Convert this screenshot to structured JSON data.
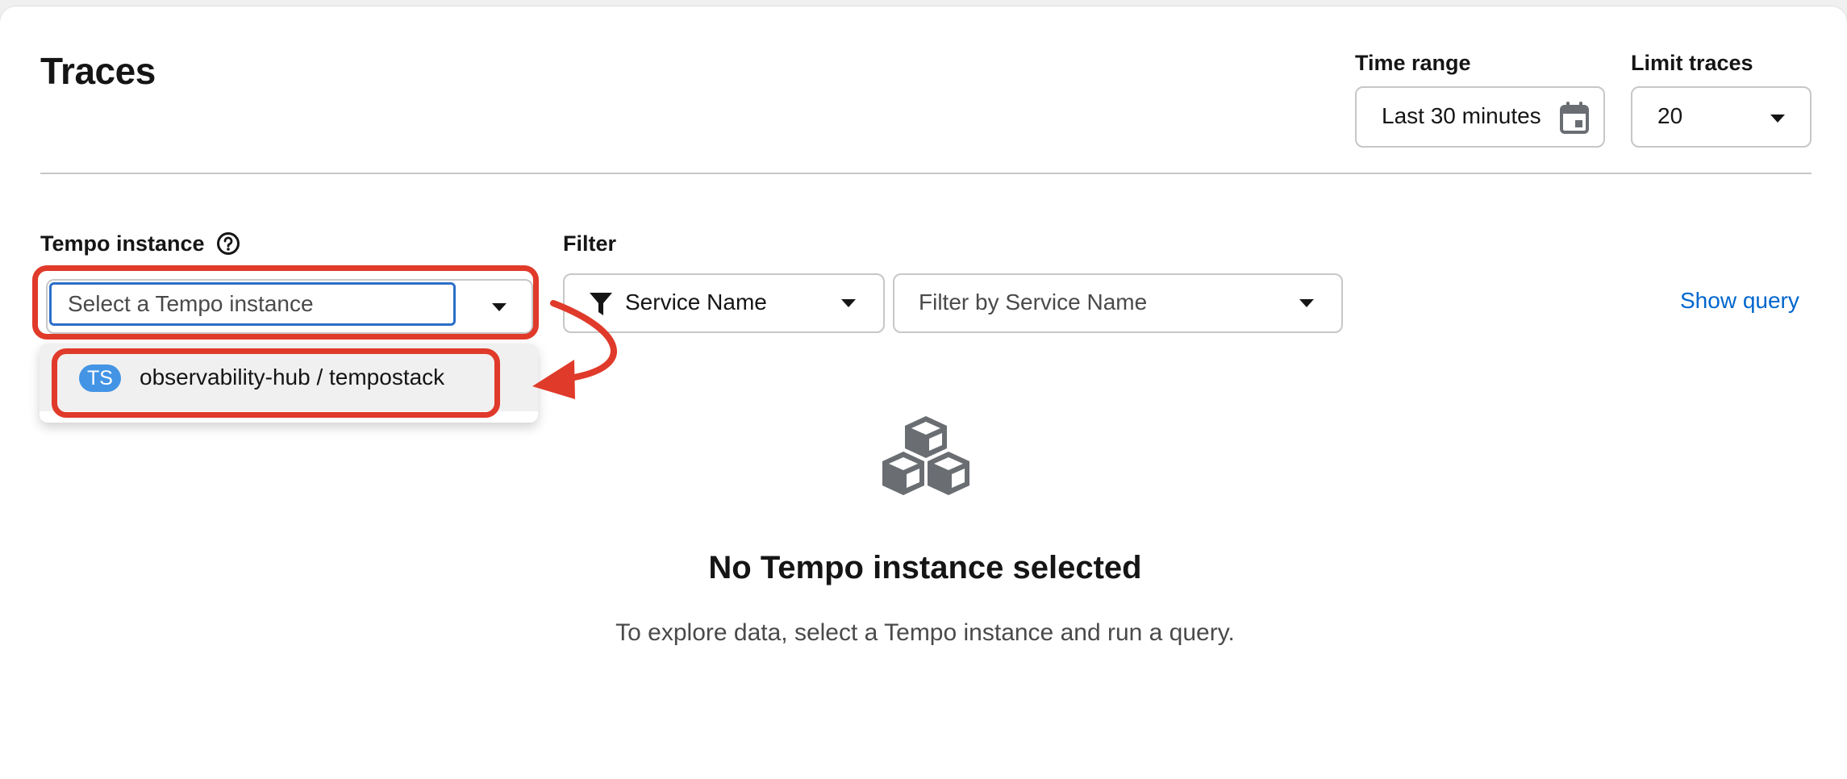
{
  "page": {
    "title": "Traces"
  },
  "time_range": {
    "label": "Time range",
    "value": "Last 30 minutes",
    "icon": "calendar-icon"
  },
  "limit_traces": {
    "label": "Limit traces",
    "value": "20"
  },
  "tempo_instance": {
    "label": "Tempo instance",
    "help_icon": "question-circle-icon",
    "placeholder": "Select a Tempo instance",
    "options": [
      {
        "badge": "TS",
        "label": "observability-hub / tempostack"
      }
    ]
  },
  "filter": {
    "label": "Filter",
    "attribute": "Service Name",
    "attribute_icon": "filter-icon",
    "value_placeholder": "Filter by Service Name",
    "show_query": "Show query"
  },
  "empty_state": {
    "icon": "cubes-icon",
    "title": "No Tempo instance selected",
    "body": "To explore data, select a Tempo instance and run a query."
  },
  "colors": {
    "accent": "#0066cc",
    "badge": "#4394e5",
    "annotation": "#e03a2a",
    "focus_border": "#2b6fc9"
  }
}
